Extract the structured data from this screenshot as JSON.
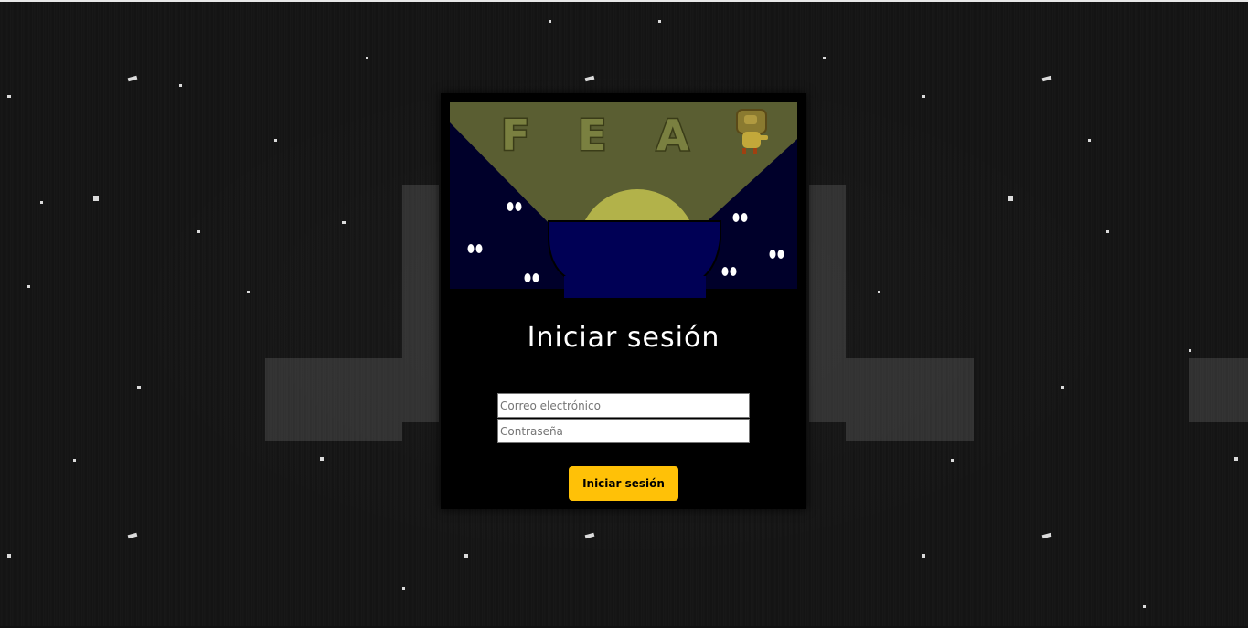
{
  "logo": {
    "letters": [
      "F",
      "E",
      "A"
    ],
    "colors": {
      "sky": "#5a5e32",
      "night": "#00002a",
      "moon": "#b2b24a",
      "bowl": "#000055",
      "letter_fill": "#7a8040",
      "letter_stroke": "#3a3c18"
    }
  },
  "login": {
    "title": "Iniciar sesión",
    "email_placeholder": "Correo electrónico",
    "password_placeholder": "Contraseña",
    "submit_label": "Iniciar sesión"
  },
  "colors": {
    "panel": "#000000",
    "button": "#ffc107"
  }
}
